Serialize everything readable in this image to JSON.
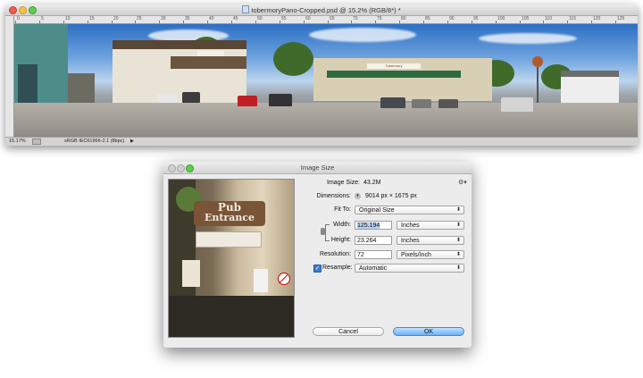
{
  "document": {
    "title": "tobermoryPano-Cropped.psd @ 15.2% (RGB/8*) *",
    "ruler_marks": [
      "0",
      "5",
      "10",
      "15",
      "20",
      "25",
      "30",
      "35",
      "40",
      "45",
      "50",
      "55",
      "60",
      "65",
      "70",
      "75",
      "80",
      "85",
      "90",
      "95",
      "100",
      "105",
      "110",
      "115",
      "120",
      "125"
    ],
    "zoom": "15.17%",
    "profile": "sRGB IEC61966-2.1 (8bpc)",
    "photo_sign_text": "Tobermory"
  },
  "dialog": {
    "title": "Image Size",
    "image_size_label": "Image Size:",
    "image_size_value": "43.2M",
    "dimensions_label": "Dimensions:",
    "dimensions_value": "9014 px  ×  1675 px",
    "fit_to_label": "Fit To:",
    "fit_to_value": "Original Size",
    "width_label": "Width:",
    "width_value": "125.194",
    "width_unit": "Inches",
    "height_label": "Height:",
    "height_value": "23.264",
    "height_unit": "Inches",
    "resolution_label": "Resolution:",
    "resolution_value": "72",
    "resolution_unit": "Pixels/Inch",
    "resample_label": "Resample:",
    "resample_value": "Automatic",
    "cancel_label": "Cancel",
    "ok_label": "OK",
    "preview_sign_line1": "Pub",
    "preview_sign_line2": "Entrance"
  },
  "icons": {
    "gear": "gear-icon",
    "chain": "link-icon",
    "dimensions_toggle": "chevron-circle-icon"
  }
}
